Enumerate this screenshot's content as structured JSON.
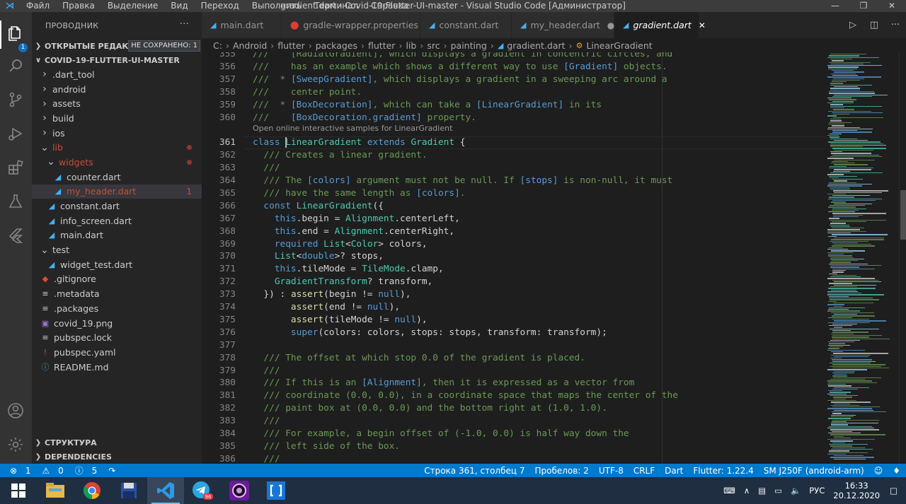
{
  "titlebar": {
    "menu": [
      "Файл",
      "Правка",
      "Выделение",
      "Вид",
      "Переход",
      "Выполнить",
      "Терминал",
      "Справка"
    ],
    "title": "gradient.dart - Covid-19-Flutter-UI-master - Visual Studio Code [Администратор]"
  },
  "activity_bar": {
    "explorer_badge": "1"
  },
  "sidebar": {
    "header": "ПРОВОДНИК",
    "open_editors": "ОТКРЫТЫЕ РЕДАКТО...",
    "unsaved_badge": "НЕ СОХРАНЕНО: 1",
    "project": "COVID-19-FLUTTER-UI-MASTER",
    "tree": [
      {
        "label": ".dart_tool",
        "type": "folder",
        "depth": 1
      },
      {
        "label": "android",
        "type": "folder",
        "depth": 1
      },
      {
        "label": "assets",
        "type": "folder",
        "depth": 1
      },
      {
        "label": "build",
        "type": "folder",
        "depth": 1
      },
      {
        "label": "ios",
        "type": "folder",
        "depth": 1
      },
      {
        "label": "lib",
        "type": "folder-open",
        "depth": 1,
        "modified": true
      },
      {
        "label": "widgets",
        "type": "folder-open",
        "depth": 2,
        "modified": true
      },
      {
        "label": "counter.dart",
        "type": "dart",
        "depth": 3
      },
      {
        "label": "my_header.dart",
        "type": "dart",
        "depth": 3,
        "selected": true,
        "errors": "1"
      },
      {
        "label": "constant.dart",
        "type": "dart",
        "depth": 2
      },
      {
        "label": "info_screen.dart",
        "type": "dart",
        "depth": 2
      },
      {
        "label": "main.dart",
        "type": "dart",
        "depth": 2
      },
      {
        "label": "test",
        "type": "folder-open",
        "depth": 1
      },
      {
        "label": "widget_test.dart",
        "type": "dart",
        "depth": 2
      },
      {
        "label": ".gitignore",
        "type": "git",
        "depth": 1
      },
      {
        "label": ".metadata",
        "type": "lines",
        "depth": 1
      },
      {
        "label": ".packages",
        "type": "lines",
        "depth": 1
      },
      {
        "label": "covid_19.png",
        "type": "image",
        "depth": 1
      },
      {
        "label": "pubspec.lock",
        "type": "lines",
        "depth": 1
      },
      {
        "label": "pubspec.yaml",
        "type": "yaml",
        "depth": 1
      },
      {
        "label": "README.md",
        "type": "info",
        "depth": 1
      }
    ],
    "structure": "СТРУКТУРА",
    "dependencies": "DEPENDENCIES"
  },
  "tabs": [
    {
      "label": "main.dart",
      "icon": "dart"
    },
    {
      "label": "gradle-wrapper.properties",
      "icon": "gradle"
    },
    {
      "label": "constant.dart",
      "icon": "dart"
    },
    {
      "label": "my_header.dart",
      "icon": "dart",
      "dirty": true
    },
    {
      "label": "gradient.dart",
      "icon": "dart",
      "active": true
    }
  ],
  "breadcrumb": [
    "C:",
    "Android",
    "flutter",
    "packages",
    "flutter",
    "lib",
    "src",
    "painting",
    "gradient.dart",
    "LinearGradient"
  ],
  "editor": {
    "codelens": "Open online interactive samples for LinearGradient",
    "lines": [
      {
        "n": "355",
        "segs": [
          [
            "c",
            "///    [RadialGradient], which displays a gradient in concentric circles, and"
          ]
        ]
      },
      {
        "n": "356",
        "segs": [
          [
            "c",
            "///    has an example which shows a different way to use "
          ],
          [
            "r",
            "[Gradient]"
          ],
          [
            "c",
            " objects."
          ]
        ]
      },
      {
        "n": "357",
        "segs": [
          [
            "c",
            "///  * "
          ],
          [
            "r",
            "[SweepGradient]"
          ],
          [
            "c",
            ", which displays a gradient in a sweeping arc around a"
          ]
        ]
      },
      {
        "n": "358",
        "segs": [
          [
            "c",
            "///    center point."
          ]
        ]
      },
      {
        "n": "359",
        "segs": [
          [
            "c",
            "///  * "
          ],
          [
            "r",
            "[BoxDecoration]"
          ],
          [
            "c",
            ", which can take a "
          ],
          [
            "r",
            "[LinearGradient]"
          ],
          [
            "c",
            " in its"
          ]
        ]
      },
      {
        "n": "360",
        "segs": [
          [
            "c",
            "///    "
          ],
          [
            "r",
            "[BoxDecoration.gradient]"
          ],
          [
            "c",
            " property."
          ]
        ]
      },
      {
        "n": "361",
        "cur": true,
        "segs": [
          [
            "k",
            "class "
          ],
          [
            "caret",
            ""
          ],
          [
            "t",
            "LinearGradient"
          ],
          [
            "k",
            " extends "
          ],
          [
            "t",
            "Gradient"
          ],
          [
            "x",
            " {"
          ]
        ]
      },
      {
        "n": "362",
        "segs": [
          [
            "c",
            "  /// Creates a linear gradient."
          ]
        ]
      },
      {
        "n": "363",
        "segs": [
          [
            "c",
            "  ///"
          ]
        ]
      },
      {
        "n": "364",
        "segs": [
          [
            "c",
            "  /// The "
          ],
          [
            "r",
            "[colors]"
          ],
          [
            "c",
            " argument must not be null. If "
          ],
          [
            "r",
            "[stops]"
          ],
          [
            "c",
            " is non-null, it must"
          ]
        ]
      },
      {
        "n": "365",
        "segs": [
          [
            "c",
            "  /// have the same length as "
          ],
          [
            "r",
            "[colors]"
          ],
          [
            "c",
            "."
          ]
        ]
      },
      {
        "n": "366",
        "segs": [
          [
            "k",
            "  const "
          ],
          [
            "t",
            "LinearGradient"
          ],
          [
            "x",
            "({"
          ]
        ]
      },
      {
        "n": "367",
        "segs": [
          [
            "k",
            "    this"
          ],
          [
            "x",
            ".begin = "
          ],
          [
            "t",
            "Alignment"
          ],
          [
            "x",
            ".centerLeft,"
          ]
        ]
      },
      {
        "n": "368",
        "segs": [
          [
            "k",
            "    this"
          ],
          [
            "x",
            ".end = "
          ],
          [
            "t",
            "Alignment"
          ],
          [
            "x",
            ".centerRight,"
          ]
        ]
      },
      {
        "n": "369",
        "segs": [
          [
            "k",
            "    required "
          ],
          [
            "t",
            "List"
          ],
          [
            "x",
            "<"
          ],
          [
            "t",
            "Color"
          ],
          [
            "x",
            "> colors,"
          ]
        ]
      },
      {
        "n": "370",
        "segs": [
          [
            "t",
            "    List"
          ],
          [
            "x",
            "<"
          ],
          [
            "k",
            "double"
          ],
          [
            "x",
            ">? stops,"
          ]
        ]
      },
      {
        "n": "371",
        "segs": [
          [
            "k",
            "    this"
          ],
          [
            "x",
            ".tileMode = "
          ],
          [
            "t",
            "TileMode"
          ],
          [
            "x",
            ".clamp,"
          ]
        ]
      },
      {
        "n": "372",
        "segs": [
          [
            "t",
            "    GradientTransform"
          ],
          [
            "x",
            "? transform,"
          ]
        ]
      },
      {
        "n": "373",
        "segs": [
          [
            "x",
            "  }) : "
          ],
          [
            "f",
            "assert"
          ],
          [
            "x",
            "(begin != "
          ],
          [
            "k",
            "null"
          ],
          [
            "x",
            "),"
          ]
        ]
      },
      {
        "n": "374",
        "segs": [
          [
            "f",
            "       assert"
          ],
          [
            "x",
            "(end != "
          ],
          [
            "k",
            "null"
          ],
          [
            "x",
            "),"
          ]
        ]
      },
      {
        "n": "375",
        "segs": [
          [
            "f",
            "       assert"
          ],
          [
            "x",
            "(tileMode != "
          ],
          [
            "k",
            "null"
          ],
          [
            "x",
            "),"
          ]
        ]
      },
      {
        "n": "376",
        "segs": [
          [
            "k",
            "       super"
          ],
          [
            "x",
            "(colors: colors, stops: stops, transform: transform);"
          ]
        ]
      },
      {
        "n": "377",
        "segs": [
          [
            "x",
            ""
          ]
        ]
      },
      {
        "n": "378",
        "segs": [
          [
            "c",
            "  /// The offset at which stop 0.0 of the gradient is placed."
          ]
        ]
      },
      {
        "n": "379",
        "segs": [
          [
            "c",
            "  ///"
          ]
        ]
      },
      {
        "n": "380",
        "segs": [
          [
            "c",
            "  /// If this is an "
          ],
          [
            "r",
            "[Alignment]"
          ],
          [
            "c",
            ", then it is expressed as a vector from"
          ]
        ]
      },
      {
        "n": "381",
        "segs": [
          [
            "c",
            "  /// coordinate (0.0, 0.0), in a coordinate space that maps the center of the"
          ]
        ]
      },
      {
        "n": "382",
        "segs": [
          [
            "c",
            "  /// paint box at (0.0, 0.0) and the bottom right at (1.0, 1.0)."
          ]
        ]
      },
      {
        "n": "383",
        "segs": [
          [
            "c",
            "  ///"
          ]
        ]
      },
      {
        "n": "384",
        "segs": [
          [
            "c",
            "  /// For example, a begin offset of (-1.0, 0.0) is half way down the"
          ]
        ]
      },
      {
        "n": "385",
        "segs": [
          [
            "c",
            "  /// left side of the box."
          ]
        ]
      },
      {
        "n": "386",
        "segs": [
          [
            "c",
            "  ///"
          ]
        ]
      }
    ]
  },
  "statusbar": {
    "errors": "1",
    "warnings": "0",
    "infos": "5",
    "position": "Строка 361, столбец 7",
    "spaces": "Пробелов: 2",
    "encoding": "UTF-8",
    "eol": "CRLF",
    "language": "Dart",
    "flutter": "Flutter: 1.22.4",
    "device": "SM J250F (android-arm)"
  },
  "taskbar": {
    "telegram_badge": "96",
    "language": "РУС",
    "time": "16:33",
    "date": "20.12.2020"
  }
}
